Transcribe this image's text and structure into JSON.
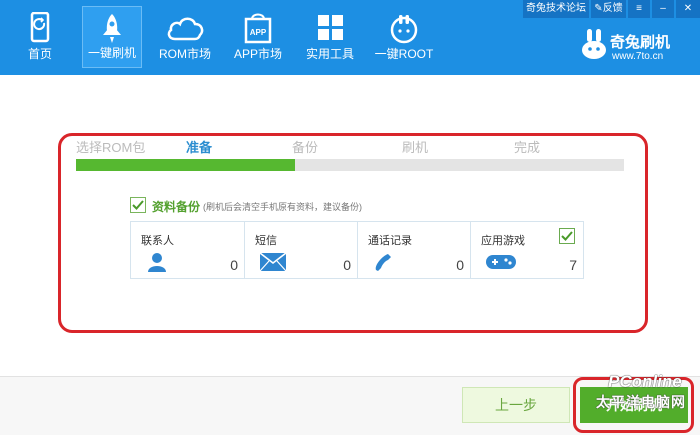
{
  "nav": {
    "items": [
      {
        "label": "首页",
        "icon": "phone-icon"
      },
      {
        "label": "一键刷机",
        "icon": "rocket-icon",
        "active": true
      },
      {
        "label": "ROM市场",
        "icon": "cloud-icon"
      },
      {
        "label": "APP市场",
        "icon": "app-bag-icon",
        "badge": "APP"
      },
      {
        "label": "实用工具",
        "icon": "tools-grid-icon"
      },
      {
        "label": "一键ROOT",
        "icon": "root-rabbit-icon"
      }
    ]
  },
  "top_right": {
    "forum": "奇兔技术论坛",
    "feedback": "反馈"
  },
  "brand": {
    "name": "奇兔刷机",
    "url": "www.7to.cn"
  },
  "steps": [
    "选择ROM包",
    "准备",
    "备份",
    "刷机",
    "完成"
  ],
  "active_step": 1,
  "progress": {
    "fraction": 0.4
  },
  "backup": {
    "title": "资料备份",
    "note": "(刷机后会清空手机原有资料，建议备份)",
    "items": [
      {
        "label": "联系人",
        "count": "0",
        "icon": "contact-icon"
      },
      {
        "label": "短信",
        "count": "0",
        "icon": "sms-envelope-icon"
      },
      {
        "label": "通话记录",
        "count": "0",
        "icon": "phone-call-icon"
      },
      {
        "label": "应用游戏",
        "count": "7",
        "icon": "gamepad-icon",
        "checked": true
      }
    ]
  },
  "buttons": {
    "prev": "上一步",
    "start": "开始刷机"
  },
  "watermark": {
    "en": "PConline",
    "cn": "太平洋电脑网"
  },
  "colors": {
    "topbar": "#1d8fe3",
    "accent_green": "#56b830",
    "highlight_red": "#d9252a"
  }
}
